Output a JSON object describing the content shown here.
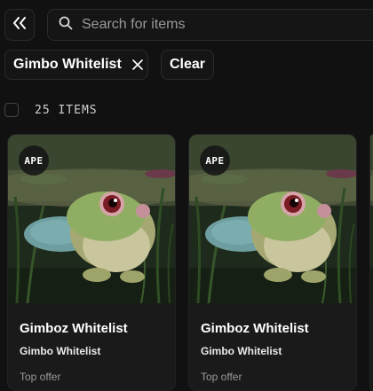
{
  "toolbar": {
    "collapse_icon": "double-chevron-left-icon",
    "search_icon": "search-icon",
    "search_placeholder": "Search for items"
  },
  "filters": {
    "active": [
      {
        "label": "Gimbo Whitelist",
        "remove_icon": "close-icon"
      }
    ],
    "clear_label": "Clear"
  },
  "results": {
    "count_label": "25 ITEMS"
  },
  "cards": [
    {
      "badge": "APE",
      "title": "Gimboz Whitelist",
      "collection": "Gimbo Whitelist",
      "offer_label": "Top offer"
    },
    {
      "badge": "APE",
      "title": "Gimboz Whitelist",
      "collection": "Gimbo Whitelist",
      "offer_label": "Top offer"
    }
  ],
  "colors": {
    "background": "#111111",
    "panel": "#151515",
    "border": "#2a2a2a",
    "card": "#1a1a1a",
    "muted_text": "#9a9a9a"
  }
}
